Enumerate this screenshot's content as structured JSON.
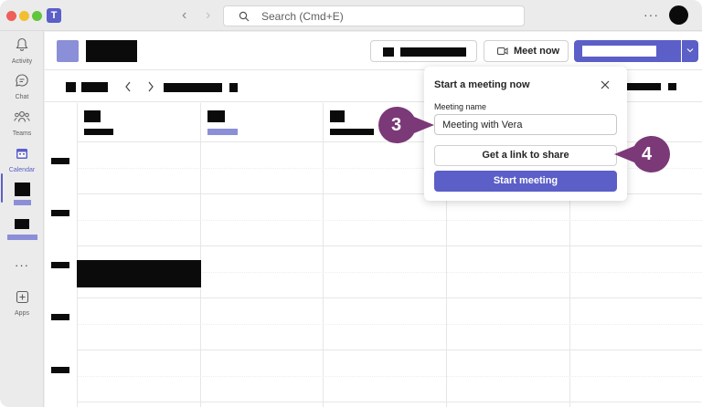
{
  "titlebar": {
    "search_placeholder": "Search (Cmd+E)",
    "back_glyph": "‹",
    "forward_glyph": "›",
    "more_glyph": "···",
    "logo_glyph": "T"
  },
  "rail": {
    "items": [
      {
        "label": "Activity",
        "icon": "bell-icon"
      },
      {
        "label": "Chat",
        "icon": "chat-icon"
      },
      {
        "label": "Teams",
        "icon": "teams-icon"
      },
      {
        "label": "Calendar",
        "icon": "calendar-icon"
      },
      {
        "label": "Apps",
        "icon": "apps-icon"
      }
    ],
    "more_glyph": "···"
  },
  "header": {
    "meet_now_label": "Meet now"
  },
  "popup": {
    "title": "Start a meeting now",
    "meeting_name_label": "Meeting name",
    "meeting_name_value": "Meeting with Vera",
    "get_link_label": "Get a link to share",
    "start_label": "Start meeting"
  },
  "callouts": {
    "step3": "3",
    "step4": "4"
  },
  "colors": {
    "accent": "#5b5fc7",
    "accent_light": "#8b8fd8",
    "callout": "#7b3978"
  }
}
